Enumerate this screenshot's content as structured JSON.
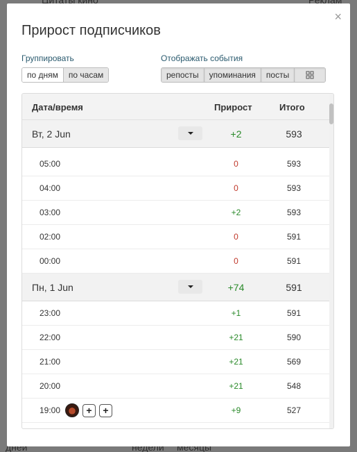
{
  "background": {
    "top_left": "Цитаты кино",
    "top_right": "Реклам",
    "bottom_left": "дней",
    "bottom_mid": "недели",
    "bottom_mid2": "месяцы"
  },
  "modal": {
    "title": "Прирост подписчиков",
    "close_symbol": "×"
  },
  "grouping": {
    "label": "Группировать",
    "options": [
      "по дням",
      "по часам"
    ]
  },
  "events": {
    "label": "Отображать события",
    "options": [
      "репосты",
      "упоминания",
      "посты"
    ],
    "extra_icon": "grid-icon"
  },
  "table": {
    "headers": {
      "date": "Дата/время",
      "delta": "Прирост",
      "total": "Итого"
    },
    "days": [
      {
        "date": "Вт, 2 Jun",
        "delta": "+2",
        "total": "593",
        "hours": [
          {
            "time": "05:00",
            "delta": "0",
            "total": "593"
          },
          {
            "time": "04:00",
            "delta": "0",
            "total": "593"
          },
          {
            "time": "03:00",
            "delta": "+2",
            "total": "593"
          },
          {
            "time": "02:00",
            "delta": "0",
            "total": "591"
          },
          {
            "time": "00:00",
            "delta": "0",
            "total": "591"
          }
        ]
      },
      {
        "date": "Пн, 1 Jun",
        "delta": "+74",
        "total": "591",
        "hours": [
          {
            "time": "23:00",
            "delta": "+1",
            "total": "591"
          },
          {
            "time": "22:00",
            "delta": "+21",
            "total": "590"
          },
          {
            "time": "21:00",
            "delta": "+21",
            "total": "569"
          },
          {
            "time": "20:00",
            "delta": "+21",
            "total": "548"
          },
          {
            "time": "19:00",
            "delta": "+9",
            "total": "527"
          }
        ]
      }
    ]
  },
  "colors": {
    "positive": "#2a8a2a",
    "zero": "#c0392b",
    "label": "#2a5a6e"
  }
}
